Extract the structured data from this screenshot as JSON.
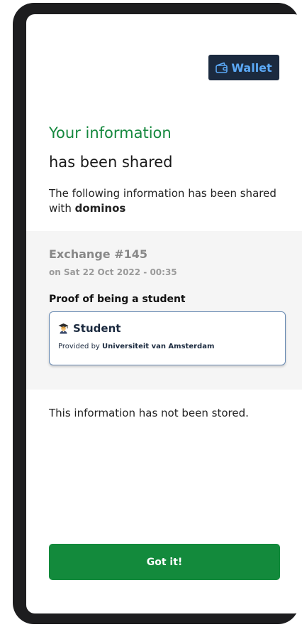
{
  "header": {
    "wallet_label": "Wallet"
  },
  "headline": {
    "line1": "Your information",
    "line2": "has been shared"
  },
  "intro": {
    "text_prefix": "The following information has been shared with ",
    "verifier": "dominos"
  },
  "exchange": {
    "title": "Exchange #145",
    "date": "on Sat 22 Oct 2022 - 00:35",
    "proof_label": "Proof of being a student",
    "credential": {
      "icon": "student-icon",
      "title": "Student",
      "provider_prefix": "Provided by ",
      "provider": "Universiteit van Amsterdam"
    }
  },
  "footer": {
    "not_stored_text": "This information has not been stored.",
    "got_it_label": "Got it!"
  },
  "colors": {
    "success_green": "#15883e",
    "button_green": "#138a3c",
    "navy": "#1b2a3f",
    "wallet_text": "#5ba8f5",
    "card_border": "#6a8bb3",
    "panel_bg": "#f5f5f5"
  }
}
